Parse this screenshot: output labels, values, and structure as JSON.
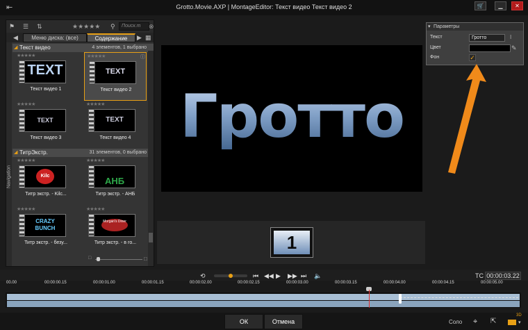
{
  "window": {
    "title": "Grotto.Movie.AXP  |  MontageEditor: Текст видео  Текст видео 2"
  },
  "library": {
    "tab_menu": "Меню диска: (все)",
    "tab_content": "Содержание",
    "search_placeholder": "Поиск.m",
    "navigation": "Navigation",
    "stars": "★★★★★",
    "groups": [
      {
        "name": "Текст видео",
        "count": "4 элементов, 1 выбрано"
      },
      {
        "name": "ТитрЭкстр.",
        "count": "31 элементов, 0 выбрано"
      }
    ],
    "items": [
      {
        "label": "Текст видео 1",
        "thumb": "TEXT"
      },
      {
        "label": "Текст видео 2",
        "thumb": "TEXT"
      },
      {
        "label": "Текст видео 3",
        "thumb": "TEXT"
      },
      {
        "label": "Текст видео 4",
        "thumb": "TEXT"
      },
      {
        "label": "Титр экстр. - Kilc...",
        "thumb": "Kilc"
      },
      {
        "label": "Титр экстр. - АНБ",
        "thumb": "АНБ"
      },
      {
        "label": "Титр экстр. - безу...",
        "thumb": "CRAZY BUNCH"
      },
      {
        "label": "Титр экстр. - в го...",
        "thumb": "Morgan's Diner"
      }
    ]
  },
  "preview": {
    "text": "Гротто"
  },
  "strip": {
    "number": "1"
  },
  "params": {
    "header": "Параметры",
    "text_label": "Текст",
    "text_value": "Гротто",
    "color_label": "Цвет",
    "bg_label": "Фон",
    "bg_checked": true
  },
  "transport": {
    "tc_label": "TC",
    "tc_value": "00:00:03.22"
  },
  "ruler": {
    "ticks": [
      "00.00",
      "00:00:00.15",
      "00:00:01.00",
      "00:00:01.15",
      "00:00:02.00",
      "00:00:02.15",
      "00:00:03.00",
      "00:00:03.15",
      "00:00:04.00",
      "00:00:04.15",
      "00:00:05.00"
    ]
  },
  "footer": {
    "ok": "ОК",
    "cancel": "Отмена",
    "solo": "Соло",
    "badge_3d": "3D"
  },
  "colors": {
    "accent": "#e8a015",
    "arrow": "#f08a1a"
  }
}
